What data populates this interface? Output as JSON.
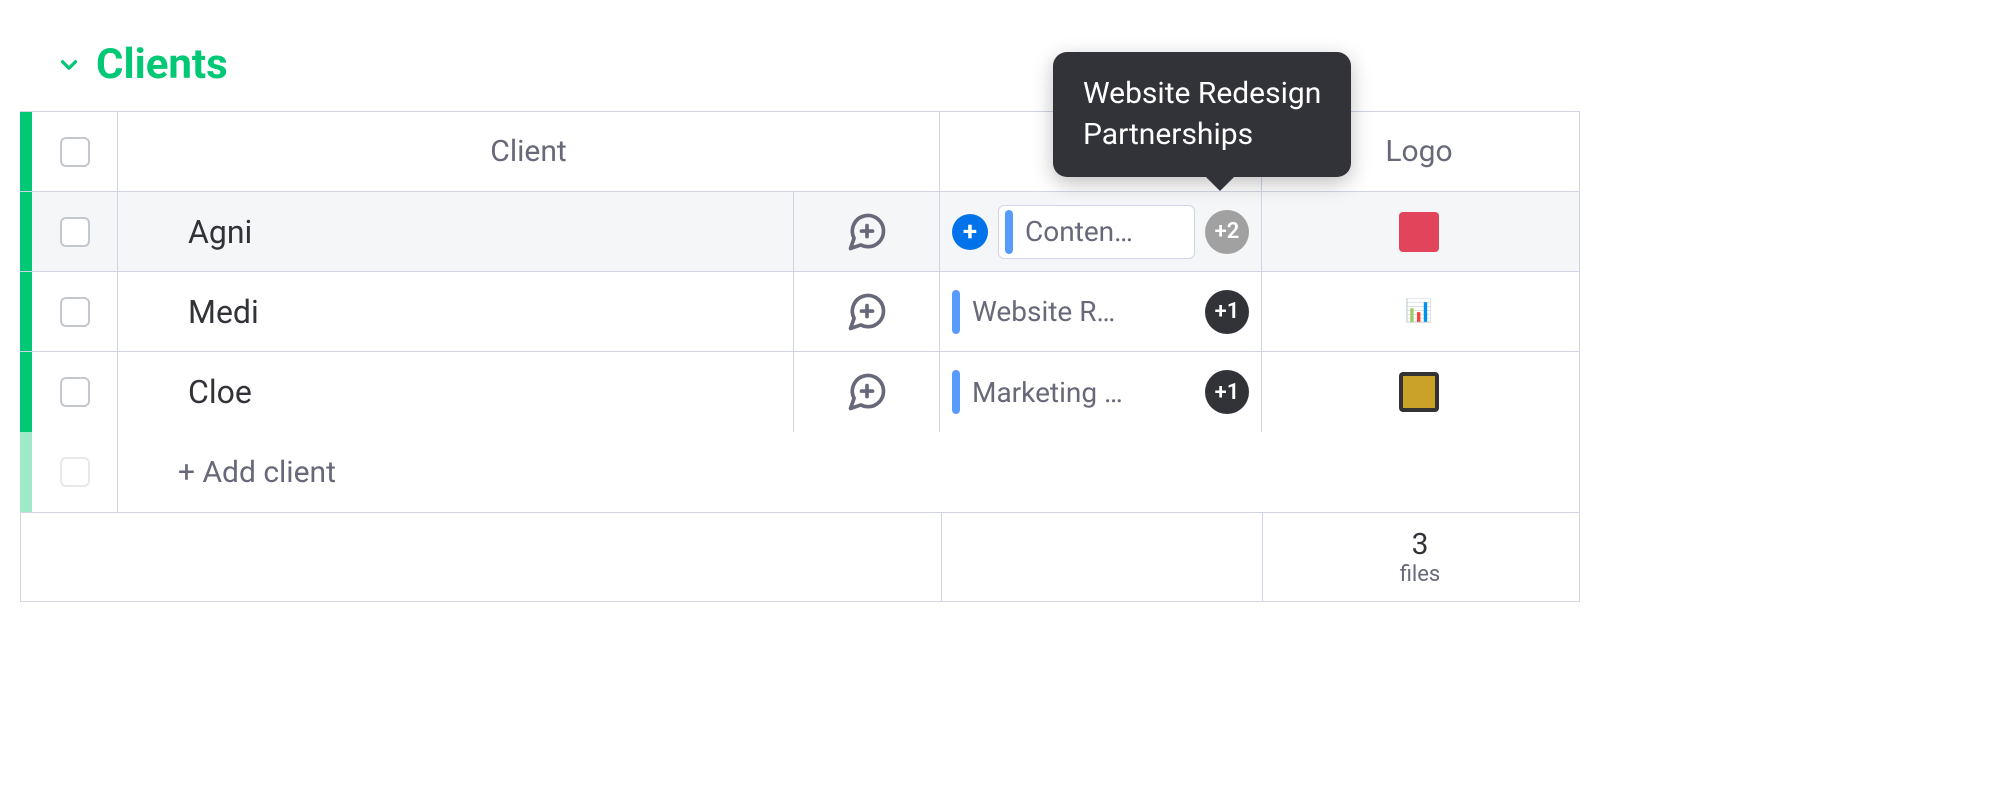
{
  "section": {
    "title": "Clients"
  },
  "columns": {
    "client": "Client",
    "logo": "Logo"
  },
  "rows": [
    {
      "name": "Agni",
      "hovered": true,
      "showPlus": true,
      "chipText": "Conten…",
      "chipBoxed": true,
      "moreCount": "+2",
      "moreGrey": true,
      "logoClass": "logo-red",
      "logoContent": ""
    },
    {
      "name": "Medi",
      "hovered": false,
      "showPlus": false,
      "chipText": "Website R…",
      "chipBoxed": false,
      "moreCount": "+1",
      "moreGrey": false,
      "logoClass": "logo-purple",
      "logoContent": "📊"
    },
    {
      "name": "Cloe",
      "hovered": false,
      "showPlus": false,
      "chipText": "Marketing …",
      "chipBoxed": false,
      "moreCount": "+1",
      "moreGrey": false,
      "logoClass": "logo-gold",
      "logoContent": ""
    }
  ],
  "addRow": "+ Add client",
  "summary": {
    "count": "3",
    "label": "files"
  },
  "tooltip": {
    "line1": "Website Redesign",
    "line2": "Partnerships"
  }
}
